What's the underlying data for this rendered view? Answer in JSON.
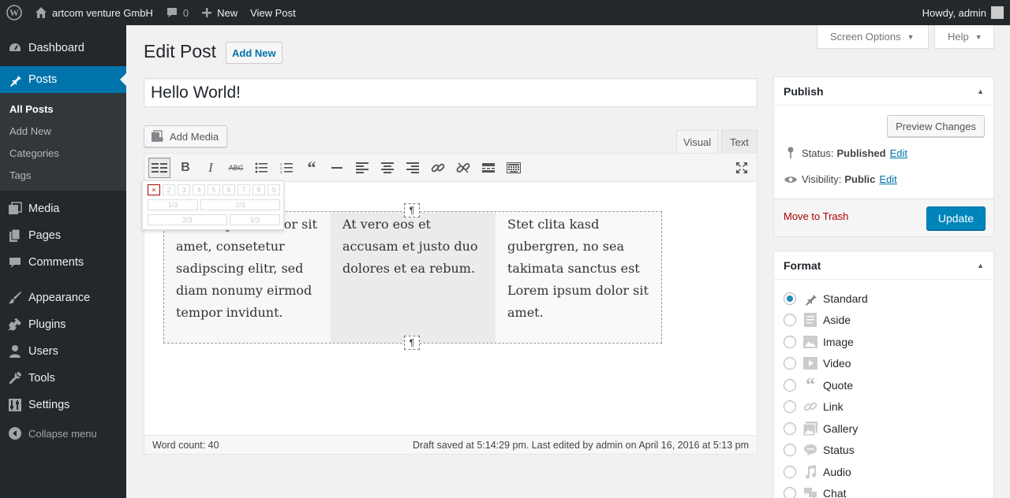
{
  "adminbar": {
    "site_name": "artcom venture GmbH",
    "comments_count": "0",
    "new_label": "New",
    "view_post_label": "View Post",
    "greeting": "Howdy, admin"
  },
  "sidebar": {
    "items": [
      {
        "label": "Dashboard",
        "icon": "dashboard-icon"
      },
      {
        "label": "Posts",
        "icon": "pin-icon"
      },
      {
        "label": "Media",
        "icon": "media-icon"
      },
      {
        "label": "Pages",
        "icon": "pages-icon"
      },
      {
        "label": "Comments",
        "icon": "comments-icon"
      },
      {
        "label": "Appearance",
        "icon": "brush-icon"
      },
      {
        "label": "Plugins",
        "icon": "plugin-icon"
      },
      {
        "label": "Users",
        "icon": "users-icon"
      },
      {
        "label": "Tools",
        "icon": "wrench-icon"
      },
      {
        "label": "Settings",
        "icon": "settings-icon"
      }
    ],
    "posts_submenu": [
      "All Posts",
      "Add New",
      "Categories",
      "Tags"
    ],
    "collapse_label": "Collapse menu"
  },
  "screen_options": {
    "label": "Screen Options",
    "help_label": "Help"
  },
  "header": {
    "title": "Edit Post",
    "add_new_label": "Add New"
  },
  "post": {
    "title": "Hello World!"
  },
  "editor": {
    "add_media_label": "Add Media",
    "tab_visual": "Visual",
    "tab_text": "Text",
    "pilcrow": "¶",
    "grid_popup": {
      "close": "×",
      "numbers": [
        "2",
        "3",
        "4",
        "5",
        "6",
        "7",
        "8",
        "9"
      ],
      "row2": [
        "1/3",
        "2/3"
      ],
      "row3": [
        "2/3",
        "1/3"
      ]
    },
    "columns": [
      "Lorem ipsum dolor sit amet, consetetur sadipscing elitr, sed diam nonumy eirmod tempor invidunt.",
      "At vero eos et accusam et justo duo dolores et ea rebum.",
      "Stet clita kasd gubergren, no sea takimata sanctus est Lorem ipsum dolor sit amet."
    ],
    "word_count": "Word count: 40",
    "draft_status": "Draft saved at 5:14:29 pm. Last edited by admin on April 16, 2016 at 5:13 pm"
  },
  "publish": {
    "title": "Publish",
    "preview_label": "Preview Changes",
    "status_label": "Status:",
    "status_value": "Published",
    "visibility_label": "Visibility:",
    "visibility_value": "Public",
    "edit_label": "Edit",
    "trash_label": "Move to Trash",
    "update_label": "Update"
  },
  "format": {
    "title": "Format",
    "options": [
      "Standard",
      "Aside",
      "Image",
      "Video",
      "Quote",
      "Link",
      "Gallery",
      "Status",
      "Audio",
      "Chat"
    ],
    "selected": "Standard"
  },
  "colors": {
    "accent": "#0073aa",
    "update_button": "#0085ba",
    "trash": "#a00000",
    "admin_bg": "#23282d"
  }
}
